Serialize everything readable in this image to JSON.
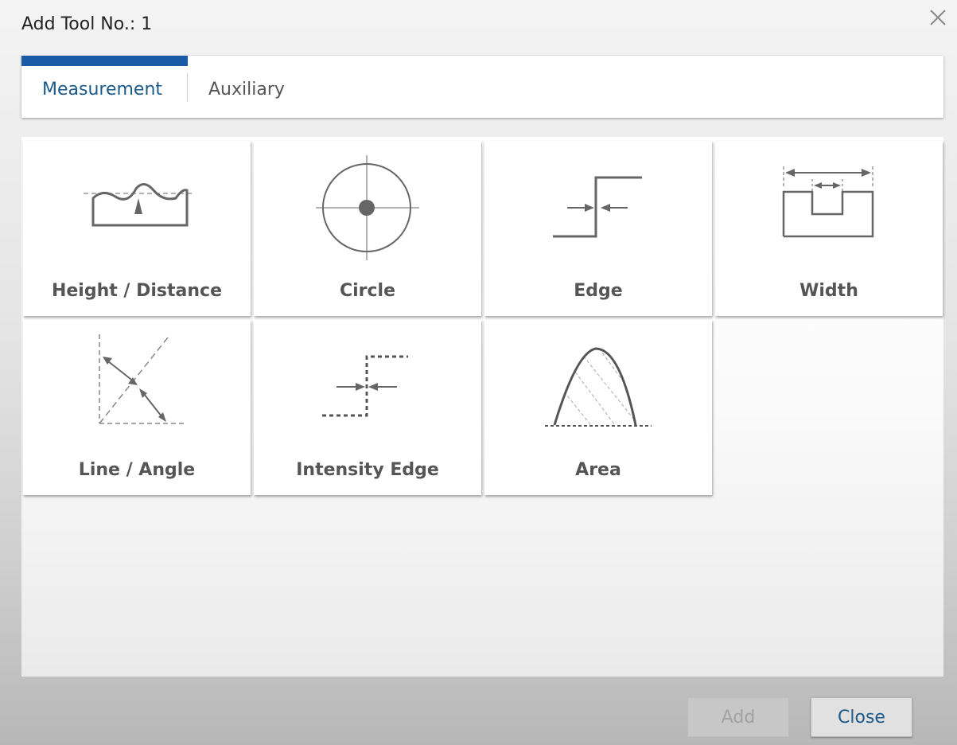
{
  "dialog": {
    "title": "Add Tool No.: 1"
  },
  "tabs": [
    {
      "label": "Measurement",
      "active": true
    },
    {
      "label": "Auxiliary",
      "active": false
    }
  ],
  "tools": [
    {
      "label": "Height / Distance",
      "icon": "height-distance-icon"
    },
    {
      "label": "Circle",
      "icon": "circle-icon"
    },
    {
      "label": "Edge",
      "icon": "edge-icon"
    },
    {
      "label": "Width",
      "icon": "width-icon"
    },
    {
      "label": "Line / Angle",
      "icon": "line-angle-icon"
    },
    {
      "label": "Intensity Edge",
      "icon": "intensity-edge-icon"
    },
    {
      "label": "Area",
      "icon": "area-icon"
    }
  ],
  "buttons": {
    "add": "Add",
    "close": "Close",
    "add_enabled": false
  },
  "colors": {
    "accent": "#1a5ba6",
    "tab_active_text": "#1c5a8c",
    "icon_stroke": "#666666"
  }
}
